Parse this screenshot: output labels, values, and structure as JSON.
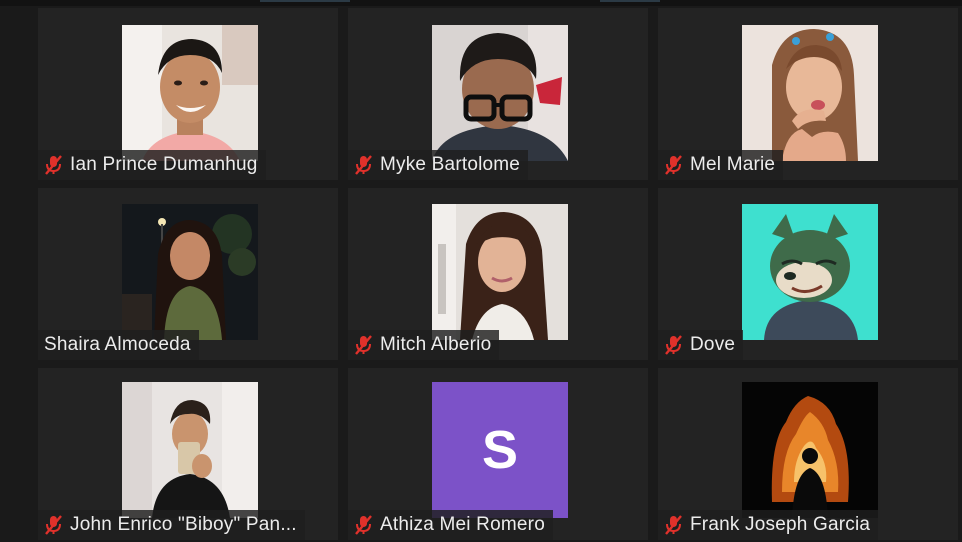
{
  "participants": [
    {
      "name": "Ian Prince Dumanhug",
      "muted": true,
      "video": "photo",
      "photo_desc": "man-smiling-selfie"
    },
    {
      "name": "Myke Bartolome",
      "muted": true,
      "video": "photo",
      "photo_desc": "man-with-glasses"
    },
    {
      "name": "Mel Marie",
      "muted": true,
      "video": "photo",
      "photo_desc": "woman-pouting"
    },
    {
      "name": "Shaira Almoceda",
      "muted": false,
      "video": "photo",
      "photo_desc": "woman-night-street"
    },
    {
      "name": "Mitch Alberio",
      "muted": true,
      "video": "photo",
      "photo_desc": "woman-selfie"
    },
    {
      "name": "Dove",
      "muted": true,
      "video": "photo",
      "photo_desc": "cartoon-dog"
    },
    {
      "name": "John Enrico \"Biboy\" Pan...",
      "muted": true,
      "video": "photo",
      "photo_desc": "man-mirror-selfie"
    },
    {
      "name": "Athiza Mei Romero",
      "muted": true,
      "video": "avatar",
      "avatar_letter": "S",
      "avatar_color": "#7c52c8"
    },
    {
      "name": "Frank Joseph Garcia",
      "muted": true,
      "video": "photo",
      "photo_desc": "silhouette-fire"
    }
  ],
  "colors": {
    "background": "#1a1a1a",
    "tile": "#232323",
    "muted_icon": "#e0312b",
    "name_text": "#ececec"
  },
  "icons": {
    "muted": "microphone-muted-icon"
  }
}
